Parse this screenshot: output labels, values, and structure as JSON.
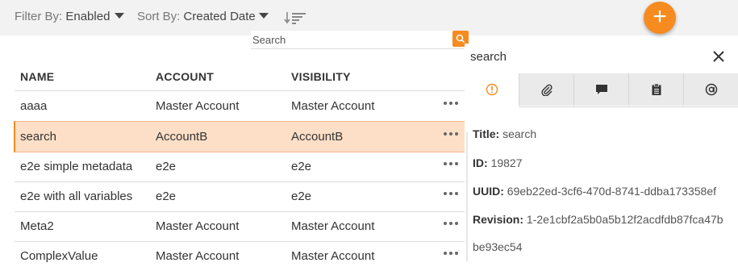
{
  "toolbar": {
    "filter_prefix": "Filter By:",
    "filter_value": "Enabled",
    "sort_prefix": "Sort By:",
    "sort_value": "Created Date",
    "add_icon": "plus-icon",
    "sort_icon": "sort-order-icon"
  },
  "search": {
    "placeholder": "Search",
    "icon": "search-icon"
  },
  "table": {
    "headers": [
      "NAME",
      "ACCOUNT",
      "VISIBILITY"
    ],
    "rows": [
      {
        "name": "aaaa",
        "account": "Master Account",
        "visibility": "Master Account"
      },
      {
        "name": "search",
        "account": "AccountB",
        "visibility": "AccountB"
      },
      {
        "name": "e2e simple metadata",
        "account": "e2e",
        "visibility": "e2e"
      },
      {
        "name": "e2e with all variables",
        "account": "e2e",
        "visibility": "e2e"
      },
      {
        "name": "Meta2",
        "account": "Master Account",
        "visibility": "Master Account"
      },
      {
        "name": "ComplexValue",
        "account": "Master Account",
        "visibility": "Master Account"
      }
    ],
    "selected_row": "search",
    "row_menu_icon": "more-horizontal-icon"
  },
  "panel": {
    "title": "search",
    "close_icon": "close-icon",
    "tabs": [
      "info-icon",
      "paperclip-icon",
      "comment-icon",
      "clipboard-icon",
      "at-sign-icon"
    ],
    "fields": {
      "title_label": "Title:",
      "title_value": "search",
      "id_label": "ID:",
      "id_value": "19827",
      "uuid_label": "UUID:",
      "uuid_value": "69eb22ed-3cf6-470d-8741-ddba173358ef",
      "revision_label": "Revision:",
      "revision_value_line1": "1-2e1cbf2a5b0a5b12f2acdfdb87fca47b",
      "revision_value_line2": "be93ec54"
    }
  },
  "colors": {
    "accent": "#f68b1f",
    "selected_row_bg": "#fddfc7",
    "toolbar_bg": "#f2f2f2"
  }
}
